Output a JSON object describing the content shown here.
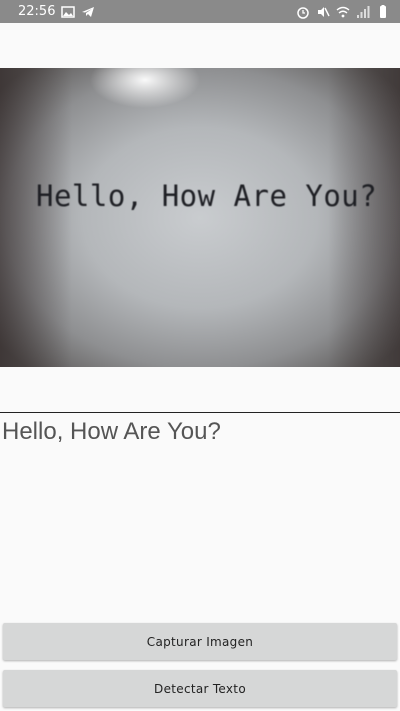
{
  "status_bar": {
    "time": "22:56",
    "left_icons": [
      "image-icon",
      "telegram-icon"
    ],
    "right_icons": [
      "alarm-icon",
      "mute-icon",
      "wifi-icon",
      "signal-icon",
      "battery-icon"
    ]
  },
  "camera_preview": {
    "text": "Hello, How Are You?"
  },
  "result": {
    "text": "Hello, How Are You?"
  },
  "buttons": {
    "capture_label": "Capturar Imagen",
    "detect_label": "Detectar Texto"
  }
}
